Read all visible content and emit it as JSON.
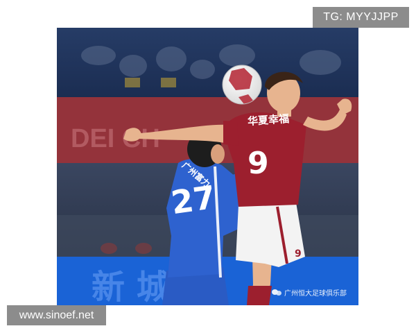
{
  "watermarks": {
    "top_right": "TG: MYYJJPP",
    "bottom_left": "www.sinoef.net",
    "club_credit": "广州恒大足球俱乐部"
  },
  "photo": {
    "subject": "two footballers challenging for a header",
    "red_player": {
      "number": "9",
      "sponsor": "华夏幸福",
      "shorts_number": "9"
    },
    "blue_player": {
      "number": "27",
      "sponsor": "广州富力",
      "name_on_shirt": ""
    }
  },
  "colors": {
    "red_kit": "#9c1f2e",
    "blue_kit": "#2a5bc4",
    "stand_blue": "#243a66",
    "board_red": "#8a2b33",
    "ad_blue": "#1a63d6"
  }
}
